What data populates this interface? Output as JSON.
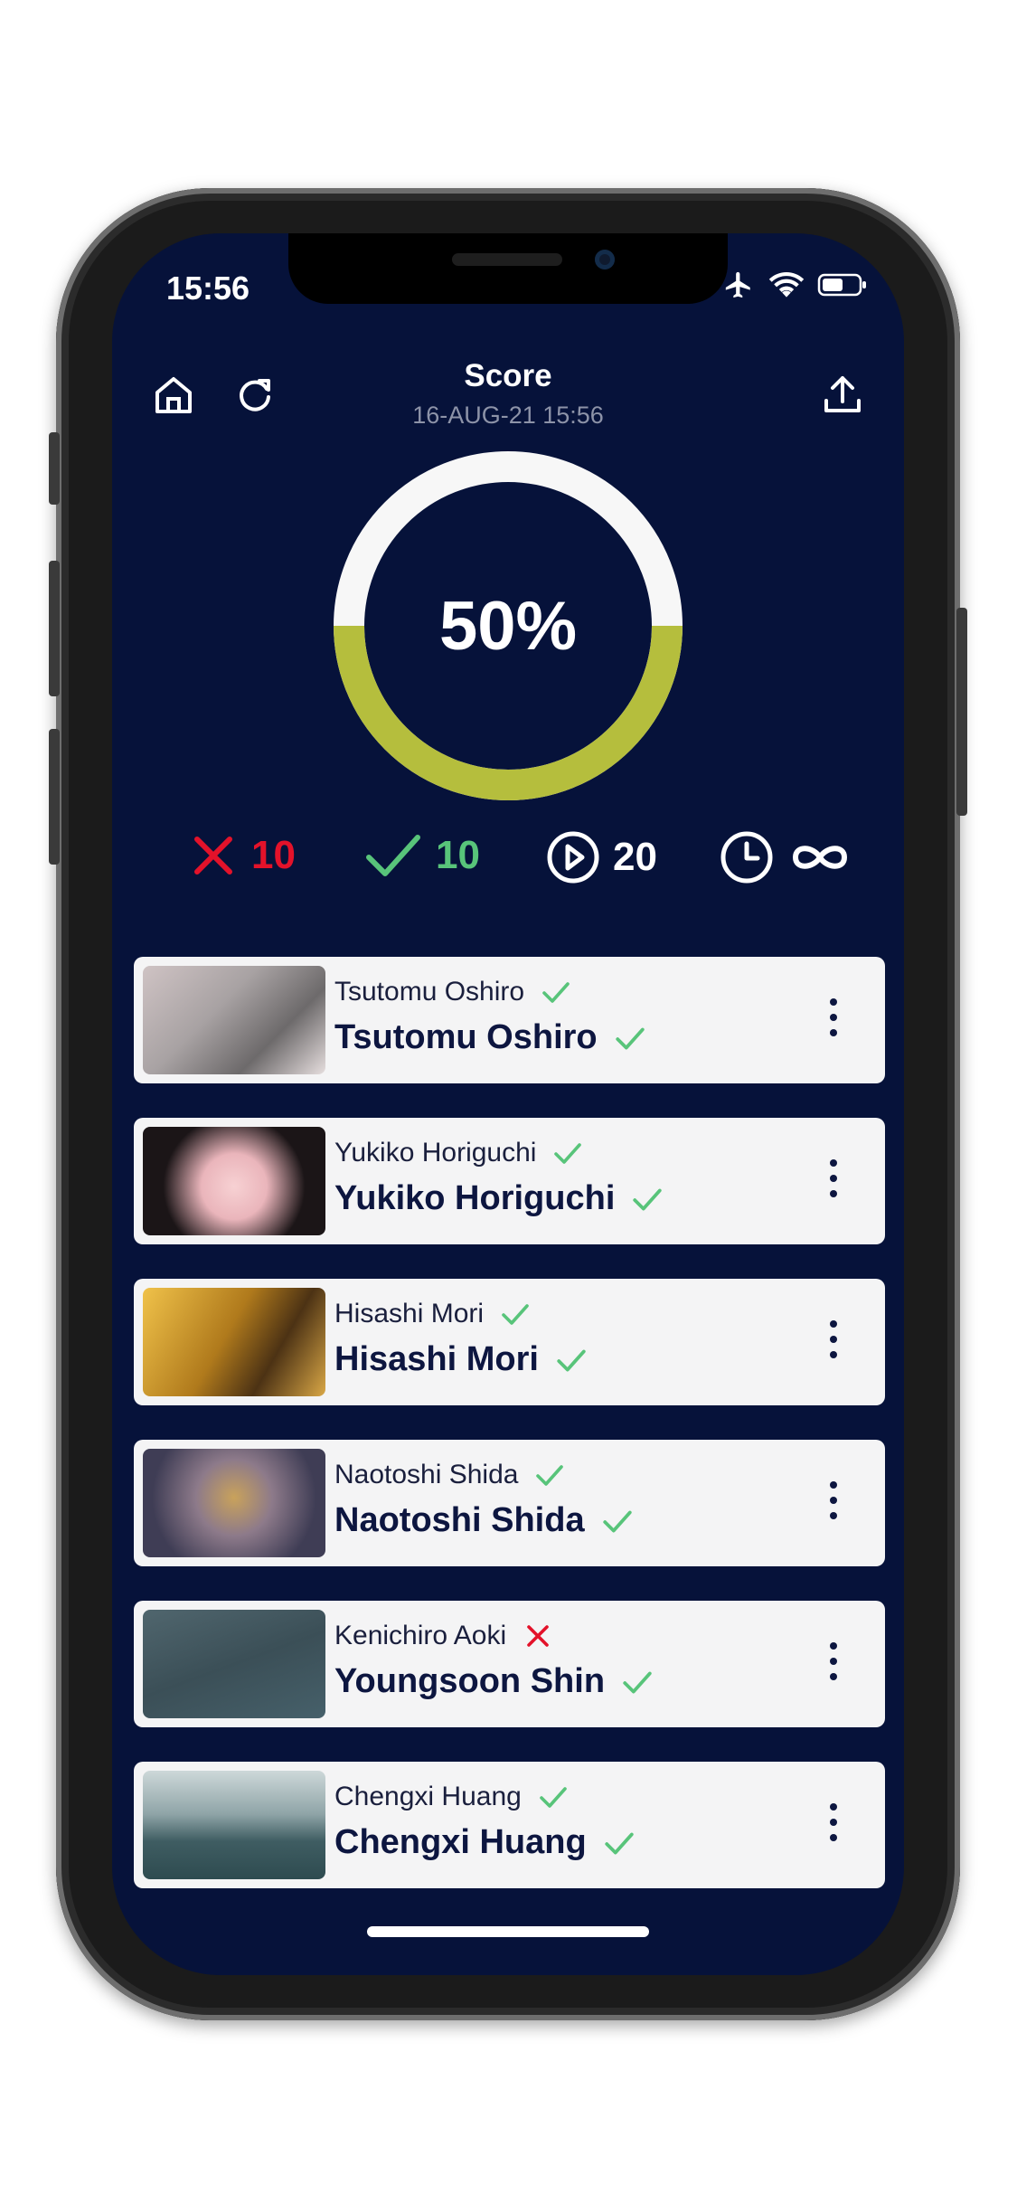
{
  "status_bar": {
    "time": "15:56"
  },
  "header": {
    "title": "Score",
    "subtitle": "16-AUG-21 15:56",
    "icons": [
      "home-icon",
      "refresh-icon",
      "share-icon"
    ]
  },
  "score": {
    "percent_label": "50%",
    "value": 0.5,
    "ring_color": "#b5be3d",
    "track_color": "#f7f7f7"
  },
  "stats": {
    "wrong": {
      "icon": "cross-icon",
      "value": "10",
      "color": "#e3122a"
    },
    "correct": {
      "icon": "check-icon",
      "value": "10",
      "color": "#58c47a"
    },
    "played": {
      "icon": "play-icon",
      "value": "20"
    },
    "time": {
      "icon": "clock-icon",
      "value_icon": "infinity-icon"
    }
  },
  "results": [
    {
      "answer": "Tsutomu Oshiro",
      "answer_correct": true,
      "expected": "Tsutomu Oshiro",
      "expected_correct": true
    },
    {
      "answer": "Yukiko Horiguchi",
      "answer_correct": true,
      "expected": "Yukiko Horiguchi",
      "expected_correct": true
    },
    {
      "answer": "Hisashi Mori",
      "answer_correct": true,
      "expected": "Hisashi Mori",
      "expected_correct": true
    },
    {
      "answer": "Naotoshi Shida",
      "answer_correct": true,
      "expected": "Naotoshi Shida",
      "expected_correct": true
    },
    {
      "answer": "Kenichiro Aoki",
      "answer_correct": false,
      "expected": "Youngsoon Shin",
      "expected_correct": true
    },
    {
      "answer": "Chengxi Huang",
      "answer_correct": true,
      "expected": "Chengxi Huang",
      "expected_correct": true
    }
  ]
}
